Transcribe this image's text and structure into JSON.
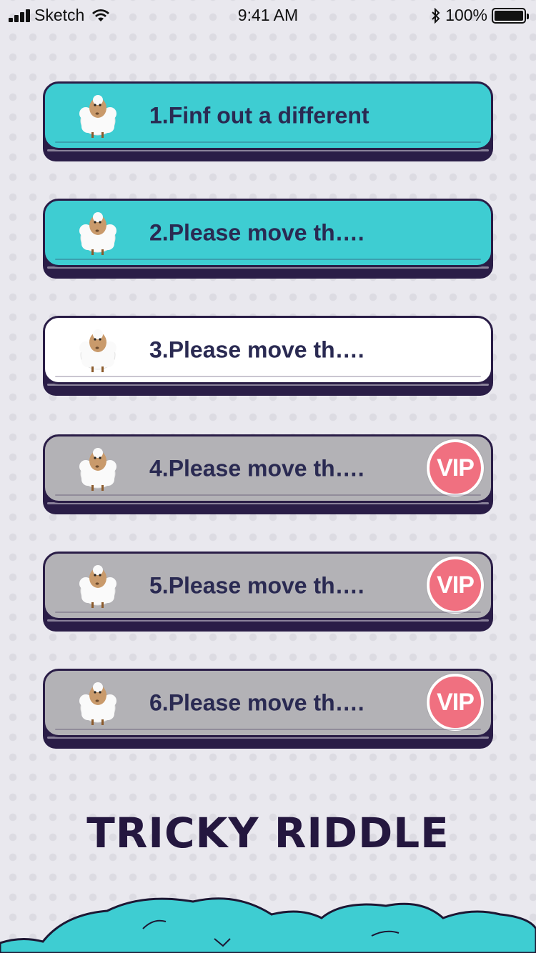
{
  "status_bar": {
    "carrier": "Sketch",
    "time": "9:41 AM",
    "battery": "100%",
    "battery_level": 1.0
  },
  "levels": [
    {
      "label": "1.Finf out a different",
      "style": "teal",
      "vip": ""
    },
    {
      "label": "2.Please move th….",
      "style": "teal",
      "vip": ""
    },
    {
      "label": "3.Please move th….",
      "style": "white",
      "vip": ""
    },
    {
      "label": "4.Please move th….",
      "style": "gray",
      "vip": "VIP"
    },
    {
      "label": "5.Please move th….",
      "style": "gray",
      "vip": "VIP"
    },
    {
      "label": "6.Please move th….",
      "style": "gray",
      "vip": "VIP"
    }
  ],
  "title": "TRICKY RIDDLE",
  "colors": {
    "teal": "#3ecdd2",
    "outline": "#2a1d47",
    "locked": "#b3b2b6",
    "vip": "#f07080",
    "background": "#e9e8ee"
  },
  "icons": {
    "level_icon": "sheep-icon",
    "vip_badge": "vip-badge"
  }
}
